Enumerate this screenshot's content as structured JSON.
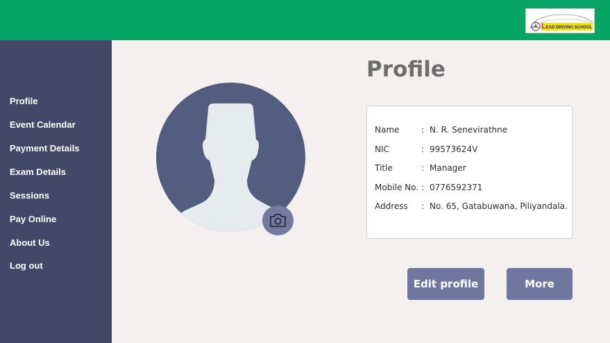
{
  "header": {
    "logo": {
      "text_initial": "L",
      "text_rest": "EAD DRIVING SCHOOL"
    }
  },
  "sidebar": {
    "items": [
      {
        "label": "Profile"
      },
      {
        "label": "Event Calendar"
      },
      {
        "label": "Payment Details"
      },
      {
        "label": "Exam Details"
      },
      {
        "label": "Sessions"
      },
      {
        "label": "Pay Online"
      },
      {
        "label": "About Us"
      },
      {
        "label": "Log out"
      }
    ]
  },
  "main": {
    "title": "Profile",
    "profile": {
      "rows": [
        {
          "label": "Name",
          "sep": ":",
          "value": "N. R. Senevirathne"
        },
        {
          "label": "NIC",
          "sep": ":",
          "value": "99573624V"
        },
        {
          "label": "Title",
          "sep": ":",
          "value": "Manager"
        },
        {
          "label": "Mobile No.",
          "sep": ":",
          "value": "0776592371"
        },
        {
          "label": "Address",
          "sep": ":",
          "value": "No. 65, Gatabuwana, Piliyandala."
        }
      ]
    },
    "buttons": {
      "edit_label": "Edit profile",
      "more_label": "More"
    },
    "icons": {
      "avatar": "user-avatar-icon",
      "camera": "camera-icon",
      "logo_car": "car-icon"
    }
  },
  "colors": {
    "header": "#06a565",
    "sidebar": "#434868",
    "background": "#f4f0f0",
    "avatar": "#525d80",
    "button": "#6f779e",
    "title": "#6e6e6e"
  }
}
